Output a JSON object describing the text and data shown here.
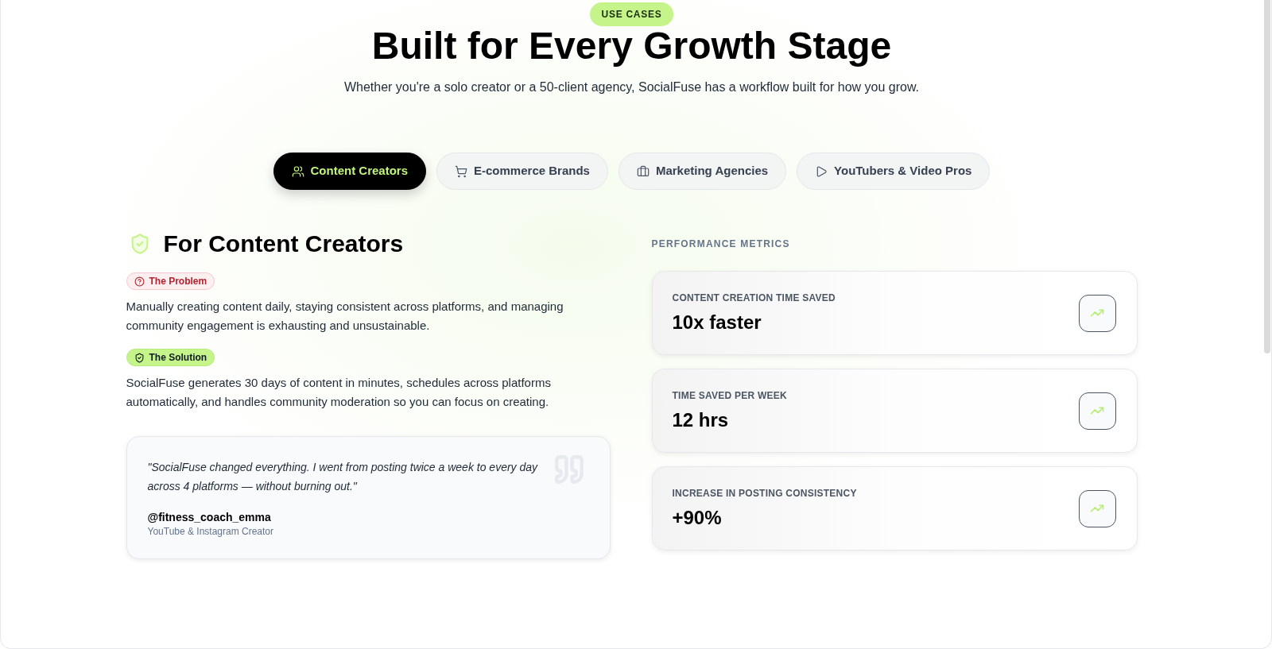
{
  "header": {
    "badge": "USE CASES",
    "title": "Built for Every Growth Stage",
    "subtitle": "Whether you're a solo creator or a 50-client agency, SocialFuse has a workflow built for how you grow."
  },
  "tabs": [
    {
      "label": "Content Creators",
      "selected": true
    },
    {
      "label": "E-commerce Brands",
      "selected": false
    },
    {
      "label": "Marketing Agencies",
      "selected": false
    },
    {
      "label": "YouTubers & Video Pros",
      "selected": false
    }
  ],
  "use_case": {
    "title": "For Content Creators",
    "blocks": [
      {
        "kind": "problem",
        "label": "The Problem",
        "text": "Manually creating content daily, staying consistent across platforms, and managing community engagement is exhausting and unsustainable."
      },
      {
        "kind": "solution",
        "label": "The Solution",
        "text": "SocialFuse generates 30 days of content in minutes, schedules across platforms automatically, and handles community moderation so you can focus on creating."
      }
    ],
    "testimonial": {
      "quote": "\"SocialFuse changed everything. I went from posting twice a week to every day across 4 platforms — without burning out.\"",
      "author": "@fitness_coach_emma",
      "role": "YouTube & Instagram Creator"
    }
  },
  "metrics": {
    "heading": "PERFORMANCE METRICS",
    "items": [
      {
        "label": "CONTENT CREATION TIME SAVED",
        "value": "10x faster"
      },
      {
        "label": "TIME SAVED PER WEEK",
        "value": "12 hrs"
      },
      {
        "label": "INCREASE IN POSTING CONSISTENCY",
        "value": "+90%"
      }
    ]
  }
}
